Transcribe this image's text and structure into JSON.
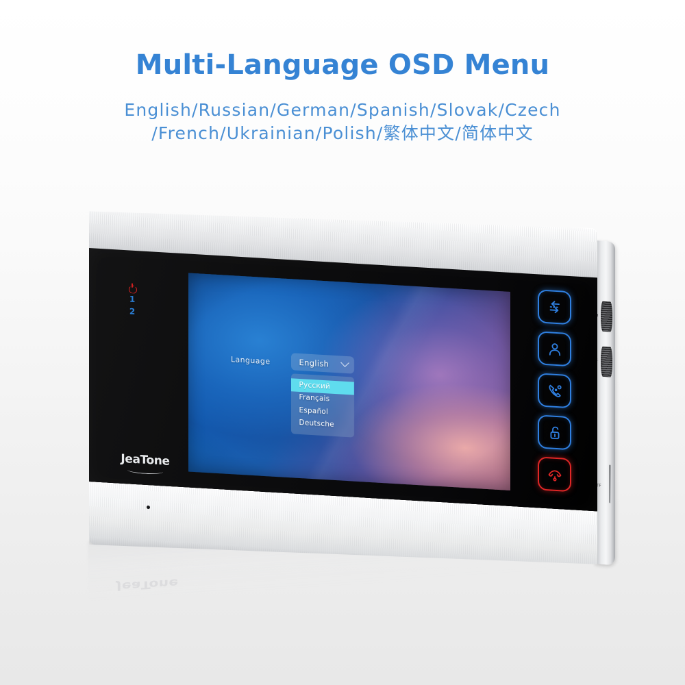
{
  "header": {
    "title": "Multi-Language OSD Menu",
    "languages_line1": "English/Russian/German/Spanish/Slovak/Czech",
    "languages_line2": "/French/Ukrainian/Polish/繁体中文/简体中文",
    "title_color": "#3583d4",
    "subtitle_color": "#4a8fd4"
  },
  "device": {
    "brand": "JeaTone",
    "indicators": {
      "power_icon": "power-icon",
      "power_color": "#cf2020",
      "line1": "1",
      "line2": "2",
      "line_color": "#2b7fd6"
    },
    "side": {
      "wheel1_icon": "gear-wheel-icon",
      "wheel2_icon": "brightness-wheel-icon",
      "tf_slot_label": "TF"
    },
    "touch_buttons": [
      {
        "name": "transfer-button",
        "icon": "transfer-arrows-icon",
        "color": "#2f7fe0"
      },
      {
        "name": "monitor-button",
        "icon": "user-icon",
        "color": "#2f7fe0"
      },
      {
        "name": "call-button",
        "icon": "phone-call-icon",
        "color": "#2f7fe0"
      },
      {
        "name": "unlock-button",
        "icon": "unlock-padlock-icon",
        "color": "#2f7fe0"
      },
      {
        "name": "hangup-button",
        "icon": "phone-hangup-icon",
        "color": "#e02626"
      }
    ]
  },
  "osd": {
    "label": "Language",
    "selected_value": "English",
    "chevron_icon": "chevron-down-icon",
    "options": [
      {
        "label": "Русский",
        "selected": true
      },
      {
        "label": "Français",
        "selected": false
      },
      {
        "label": "Español",
        "selected": false
      },
      {
        "label": "Deutsche",
        "selected": false
      }
    ],
    "highlight_color": "#5fdcee"
  }
}
